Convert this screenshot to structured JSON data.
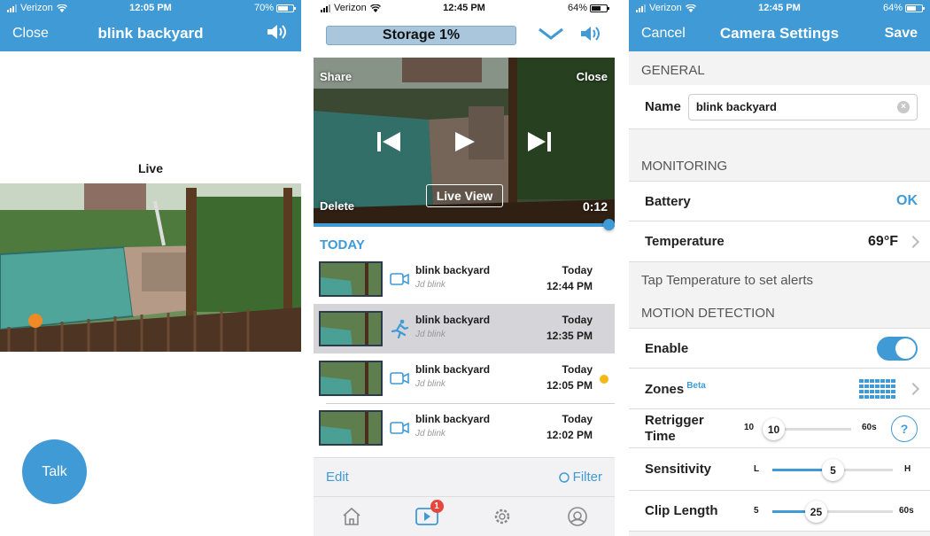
{
  "panel_live": {
    "status": {
      "carrier": "Verizon",
      "time": "12:05 PM",
      "battery": "70%"
    },
    "close_label": "Close",
    "title": "blink backyard",
    "live_label": "Live",
    "talk_label": "Talk"
  },
  "panel_clips": {
    "status": {
      "carrier": "Verizon",
      "time": "12:45 PM",
      "battery": "64%"
    },
    "storage_label": "Storage 1%",
    "player": {
      "share": "Share",
      "close": "Close",
      "delete": "Delete",
      "live_view": "Live View",
      "duration": "0:12",
      "progress": 1.0
    },
    "section_label": "TODAY",
    "clips": [
      {
        "name": "blink backyard",
        "user": "Jd blink",
        "day": "Today",
        "time": "12:44 PM",
        "icon": "camera-icon"
      },
      {
        "name": "blink backyard",
        "user": "Jd blink",
        "day": "Today",
        "time": "12:35 PM",
        "icon": "motion-runner-icon"
      },
      {
        "name": "blink backyard",
        "user": "Jd blink",
        "day": "Today",
        "time": "12:05 PM",
        "icon": "camera-icon"
      },
      {
        "name": "blink backyard",
        "user": "Jd blink",
        "day": "Today",
        "time": "12:02 PM",
        "icon": "camera-icon"
      }
    ],
    "edit_label": "Edit",
    "filter_label": "Filter",
    "tab_badge": "1"
  },
  "panel_settings": {
    "status": {
      "carrier": "Verizon",
      "time": "12:45 PM",
      "battery": "64%"
    },
    "cancel_label": "Cancel",
    "title": "Camera Settings",
    "save_label": "Save",
    "general_header": "GENERAL",
    "name_label": "Name",
    "name_value": "blink backyard",
    "monitoring_header": "MONITORING",
    "battery_label": "Battery",
    "battery_value": "OK",
    "temperature_label": "Temperature",
    "temperature_value": "69°F",
    "temperature_note": "Tap Temperature to set alerts",
    "motion_header": "MOTION DETECTION",
    "enable_label": "Enable",
    "enable_on": true,
    "zones_label": "Zones",
    "zones_badge": "Beta",
    "retrigger_label": "Retrigger Time",
    "retrigger": {
      "min": "10",
      "max": "60s",
      "value": "10",
      "fraction": 0.0
    },
    "help_label": "?",
    "sensitivity_label": "Sensitivity",
    "sensitivity": {
      "min": "L",
      "max": "H",
      "value": "5",
      "fraction": 0.5
    },
    "clip_length_label": "Clip Length",
    "clip_length": {
      "min": "5",
      "max": "60s",
      "value": "25",
      "fraction": 0.36
    }
  },
  "colors": {
    "accent": "#3f9ad6",
    "selected_row": "#d4d4d9",
    "battery_ok": "#3f9ad6",
    "unread_dot": "#f3b816",
    "badge": "#e8453c"
  }
}
